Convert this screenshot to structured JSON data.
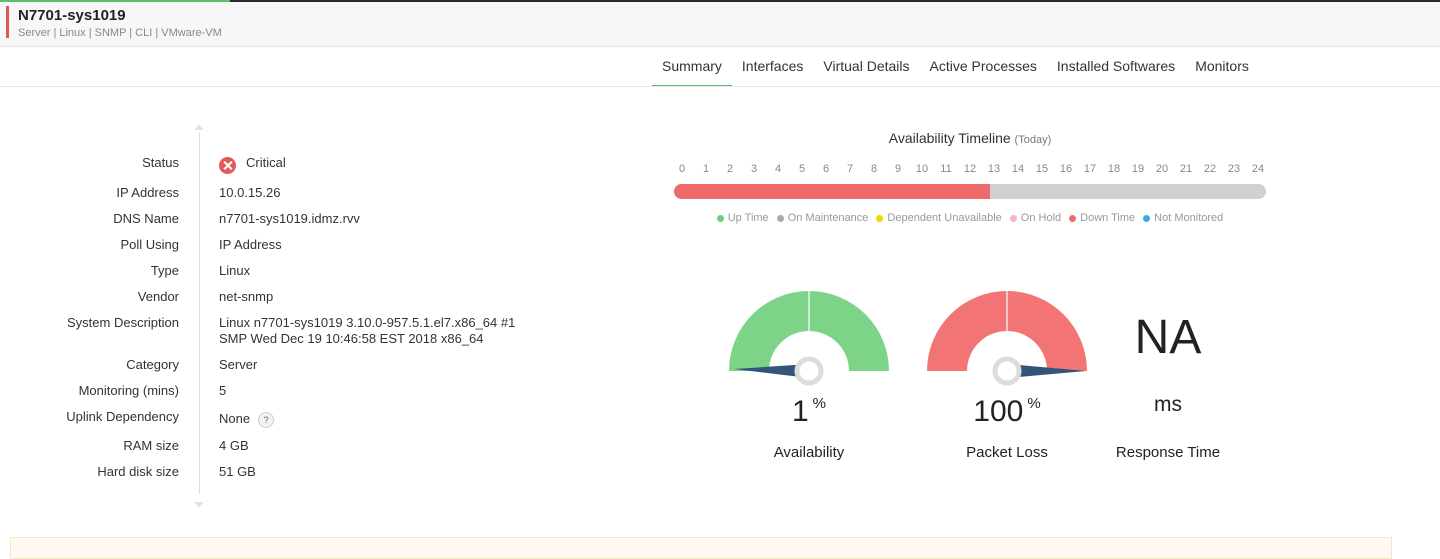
{
  "device": {
    "name": "N7701-sys1019",
    "tags": "Server | Linux  | SNMP  | CLI  | VMware-VM"
  },
  "tabs": [
    {
      "label": "Summary",
      "active": true
    },
    {
      "label": "Interfaces"
    },
    {
      "label": "Virtual Details"
    },
    {
      "label": "Active Processes"
    },
    {
      "label": "Installed Softwares"
    },
    {
      "label": "Monitors"
    }
  ],
  "properties": {
    "status_label": "Status",
    "status_value": "Critical",
    "status_icon": "critical-x-icon",
    "ip_label": "IP Address",
    "ip_value": "10.0.15.26",
    "dns_label": "DNS Name",
    "dns_value": "n7701-sys1019.idmz.rvv",
    "poll_label": "Poll Using",
    "poll_value": "IP Address",
    "type_label": "Type",
    "type_value": "Linux",
    "vendor_label": "Vendor",
    "vendor_value": "net-snmp",
    "sysdesc_label": "System Description",
    "sysdesc_line1": "Linux n7701-sys1019 3.10.0-957.5.1.el7.x86_64 #1",
    "sysdesc_line2": "SMP Wed Dec 19 10:46:58 EST 2018 x86_64",
    "category_label": "Category",
    "category_value": "Server",
    "monitoring_label": "Monitoring (mins)",
    "monitoring_value": "5",
    "uplink_label": "Uplink Dependency",
    "uplink_value": "None",
    "uplink_help": "?",
    "ram_label": "RAM size",
    "ram_value": "4 GB",
    "disk_label": "Hard disk size",
    "disk_value": "51 GB"
  },
  "timeline": {
    "title": "Availability Timeline",
    "subtitle": "(Today)",
    "hours": [
      "0",
      "1",
      "2",
      "3",
      "4",
      "5",
      "6",
      "7",
      "8",
      "9",
      "10",
      "11",
      "12",
      "13",
      "14",
      "15",
      "16",
      "17",
      "18",
      "19",
      "20",
      "21",
      "22",
      "23",
      "24"
    ],
    "down_until_hour": 12.8,
    "colors": {
      "down": "#ef6b6b",
      "rest": "#d0d0d0"
    },
    "legend": [
      {
        "label": "Up Time",
        "color": "#6fcf7f"
      },
      {
        "label": "On Maintenance",
        "color": "#aaaaaa"
      },
      {
        "label": "Dependent Unavailable",
        "color": "#f2d600"
      },
      {
        "label": "On Hold",
        "color": "#f7b6c2"
      },
      {
        "label": "Down Time",
        "color": "#ef6b6b"
      },
      {
        "label": "Not Monitored",
        "color": "#3ba7e8"
      }
    ]
  },
  "gauges": {
    "availability": {
      "value": "1",
      "unit": "%",
      "label": "Availability",
      "percent": 1,
      "color": "#7dd488"
    },
    "packet_loss": {
      "value": "100",
      "unit": "%",
      "label": "Packet Loss",
      "percent": 100,
      "color": "#f27474"
    }
  },
  "response_time": {
    "value": "NA",
    "unit": "ms",
    "label": "Response Time"
  }
}
